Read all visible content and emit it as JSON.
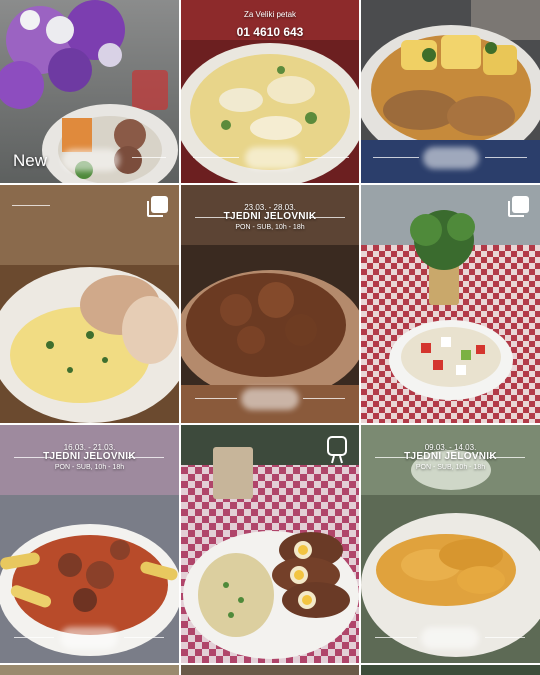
{
  "colors": {
    "overlay_text": "#ffffff",
    "grid_gap": "#ffffff"
  },
  "posts": [
    {
      "id": "post-1",
      "badge": "New",
      "scene": "flowers and plated dish",
      "icon": null
    },
    {
      "id": "post-2",
      "caption_line1": "Za Veliki petak",
      "caption_line2": "01 4610 643",
      "scene": "fish stew in white sauce",
      "icon": null
    },
    {
      "id": "post-3",
      "scene": "meat with potatoes in sauce",
      "icon": null
    },
    {
      "id": "post-4",
      "scene": "stuffed rolls with mashed potatoes",
      "icon": "multiple-images-icon"
    },
    {
      "id": "post-5",
      "dates": "23.03. - 28.03.",
      "title": "TJEDNI JELOVNIK",
      "hours": "PON - SUB, 10h - 18h",
      "scene": "goulash in ladle",
      "icon": null
    },
    {
      "id": "post-6",
      "scene": "salad on checkered tablecloth",
      "icon": "multiple-images-icon"
    },
    {
      "id": "post-7",
      "dates": "16.03. - 21.03.",
      "title": "TJEDNI JELOVNIK",
      "hours": "PON - SUB, 10h - 18h",
      "scene": "penne with meat sauce",
      "icon": null
    },
    {
      "id": "post-8",
      "scene": "meatloaf with egg and risotto",
      "icon": "reel-icon"
    },
    {
      "id": "post-9",
      "dates": "09.03. - 14.03.",
      "title": "TJEDNI JELOVNIK",
      "hours": "PON - SUB, 10h - 18h",
      "scene": "breaded rolls on plate",
      "icon": null
    }
  ]
}
